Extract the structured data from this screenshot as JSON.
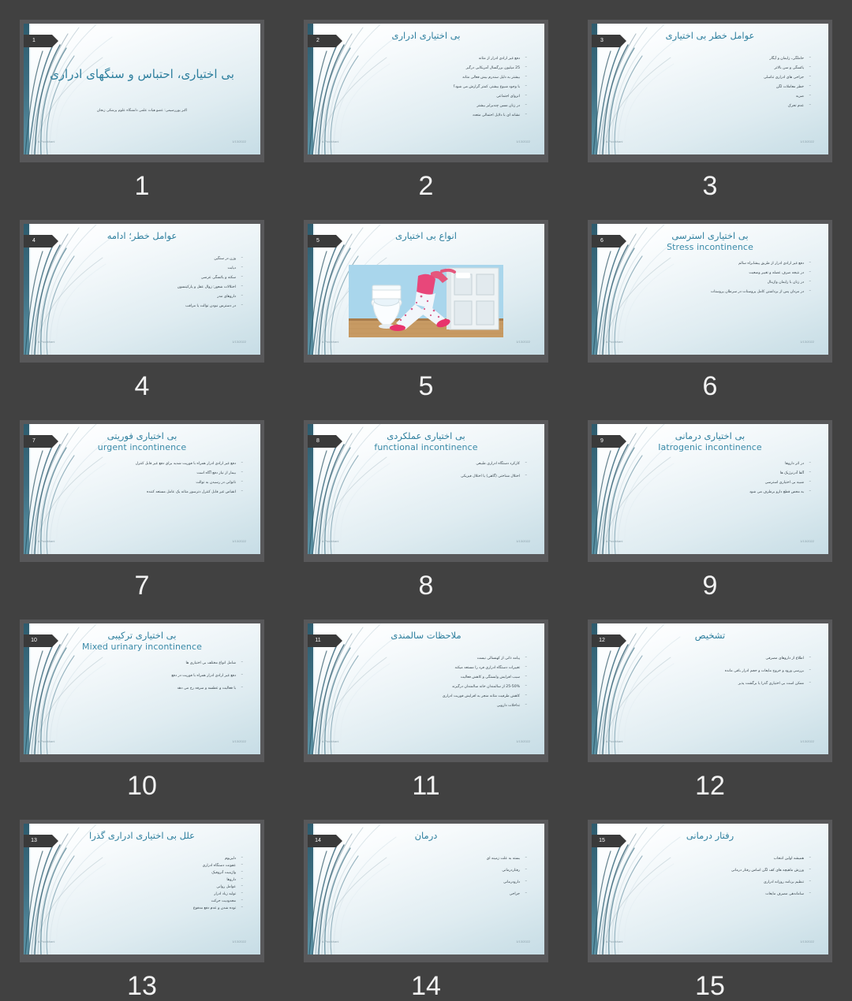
{
  "app": {
    "background_color": "#414141",
    "accent_color": "#2e7f9e",
    "ribbon_color": "#3a3a3a",
    "slide_count": 15
  },
  "footer": {
    "author": "d.Poorkhani",
    "date": "1/13/2022"
  },
  "slides": [
    {
      "number": "3",
      "caption": "3",
      "title_fa": "عوامل خطر بی اختیاری",
      "title_en": "",
      "kind": "bullets",
      "bullets": [
        "حاملگی، زایمان و آپگار",
        "یائسگی و سن بالاتر",
        "جراحی های ادراری تناسلی",
        "خطر معاملات لگن",
        "ضربه",
        "عدم تحرک"
      ]
    },
    {
      "number": "2",
      "caption": "2",
      "title_fa": "بی اختیاری ادراری",
      "title_en": "",
      "kind": "bullets",
      "bullets": [
        "دفع غیر ارادی ادرار از مثانه",
        "25 میلیون بزرگسال آمریکایی درگیر",
        "بیشتر به دلیل سندرم بیش فعالی مثانه",
        "با وجود شیوع بیشتر، کمتر گزارش می شود؟",
        "انزوای اجتماعی",
        "در زنان مسن چندبرابر بیشتر",
        "نشانه ای با دلایل احتمالی متعدد"
      ]
    },
    {
      "number": "1",
      "caption": "1",
      "title_fa": "بی اختیاری، احتباس و سنگهای ادراری",
      "title_en": "",
      "kind": "title",
      "subtitle": "اکبر پوررضیمی: عضو هیات علمی دانشگاه علوم پزشکی زنجان",
      "bullets": []
    },
    {
      "number": "6",
      "caption": "6",
      "title_fa": "بی اختیاری استرسی",
      "title_en": "Stress incontinence",
      "kind": "bullets",
      "bullets": [
        "دفع غیر ارادی ادرار از طریق پیشابراه سالم",
        "در نتیجه صرف عضله و تغییر وضعیت",
        "در زنان با زایمان واژینال",
        "در مردان پس از برداشتن کامل پروستات در سرطان پروستات"
      ]
    },
    {
      "number": "5",
      "caption": "5",
      "title_fa": "انواع بی اختیاری",
      "title_en": "",
      "kind": "photo",
      "photo_alt": "کودک در حال دویدن به سمت توالت",
      "bullets": []
    },
    {
      "number": "4",
      "caption": "4",
      "title_fa": "عوامل خطر؛ ادامه",
      "title_en": "",
      "kind": "bullets",
      "bullets": [
        "وزن در سنگین",
        "دیابت",
        "سکته و یائسگی عرضی",
        "اختلالات شعور: زوال عقل و پارکینسون",
        "داروهای مدر",
        "در دسترس نبودن توالت یا مراقب"
      ]
    },
    {
      "number": "9",
      "caption": "9",
      "title_fa": "بی اختیاری درمانی",
      "title_en": "Iatrogenic incontinence",
      "kind": "bullets",
      "bullets": [
        "در اثر داروها",
        "آلفا آدرنرژیک ها",
        "شبیه بی اختیاری استرسی",
        "به محض قطع دارو برطرف می شود"
      ]
    },
    {
      "number": "8",
      "caption": "8",
      "title_fa": "بی اختیاری عملکردی",
      "title_en": "functional incontinence",
      "kind": "bullets",
      "bullets": [
        "کارکرد دستگاه ادراری طبیعی",
        "اختلال شناختی (گاهی) یا اختلال فیزیکی"
      ]
    },
    {
      "number": "7",
      "caption": "7",
      "title_fa": "بی اختیاری فوریتی",
      "title_en": "urgent incontinence",
      "kind": "bullets",
      "bullets": [
        "دفع غیر ارادی ادرار همراه با فوریت شدید برای دفع غیر قابل کنترل",
        "بیمار از نیاز دفع آگاه است",
        "ناتوانی در رسیدن به توالت",
        "انقباض غیر قابل کنترل دترسور مثانه یک عامل مستعد کننده"
      ]
    },
    {
      "number": "12",
      "caption": "12",
      "title_fa": "تشخیص",
      "title_en": "",
      "kind": "bullets",
      "bullets": [
        "اطلاع از داروهای مصرفی",
        "بررسی ورود و خروج مایعات و حجم ادرار باقی مانده",
        "ممکن است بی اختیاری گذرا یا برگشت پذیر"
      ]
    },
    {
      "number": "11",
      "caption": "11",
      "title_fa": "ملاحظات سالمندی",
      "title_en": "",
      "kind": "bullets",
      "bullets": [
        "پیامد ذاتی از کهنسالی نیست",
        "تغییرات دستگاه ادراری فرد را مستعد میکند",
        "سبب افزایش وابستگی و کاهش فعالیت",
        "25-50% از سالمندان خانه سالمندان درگیرند",
        "کاهش ظرفیت مثانه منجر به افزایش فوریت ادراری",
        "تداخلات دارویی"
      ]
    },
    {
      "number": "10",
      "caption": "10",
      "title_fa": "بی اختیاری ترکیبی",
      "title_en": "Mixed urinary incontinence",
      "kind": "bullets",
      "bullets": [
        "شامل انواع مختلف بی اختیاری ها",
        "دفع غیر ارادی ادرار همراه با فوریت در دفع",
        "با فعالیت و عطسه و سرفه رخ می دهد"
      ]
    },
    {
      "number": "15",
      "caption": "15",
      "title_fa": "رفتار درمانی",
      "title_en": "",
      "kind": "bullets",
      "bullets": [
        "همیشه اولین انتخاب",
        "ورزش ماهیچه های کف لگن اساس رفتار درمانی",
        "تنظیم برنامه روزانه ادراری",
        "ساماندهی مصرف مایعات"
      ]
    },
    {
      "number": "14",
      "caption": "14",
      "title_fa": "درمان",
      "title_en": "",
      "kind": "bullets",
      "bullets": [
        "بسته به علت زمینه ای",
        "رفتاردرمانی",
        "دارودرمانی",
        "جراحی"
      ]
    },
    {
      "number": "13",
      "caption": "13",
      "title_fa": "علل بی اختیاری ادراری گذرا",
      "title_en": "",
      "kind": "bullets",
      "bullets": [
        "دلیریوم",
        "عفونت دستگاه ادراری",
        "واژینیت آتروفیک",
        "داروها",
        "عوامل روانی",
        "تولید زیاد ادرار",
        "محدودیت حرکت",
        "توده شدن و عدم دفع مدفوع"
      ]
    }
  ]
}
